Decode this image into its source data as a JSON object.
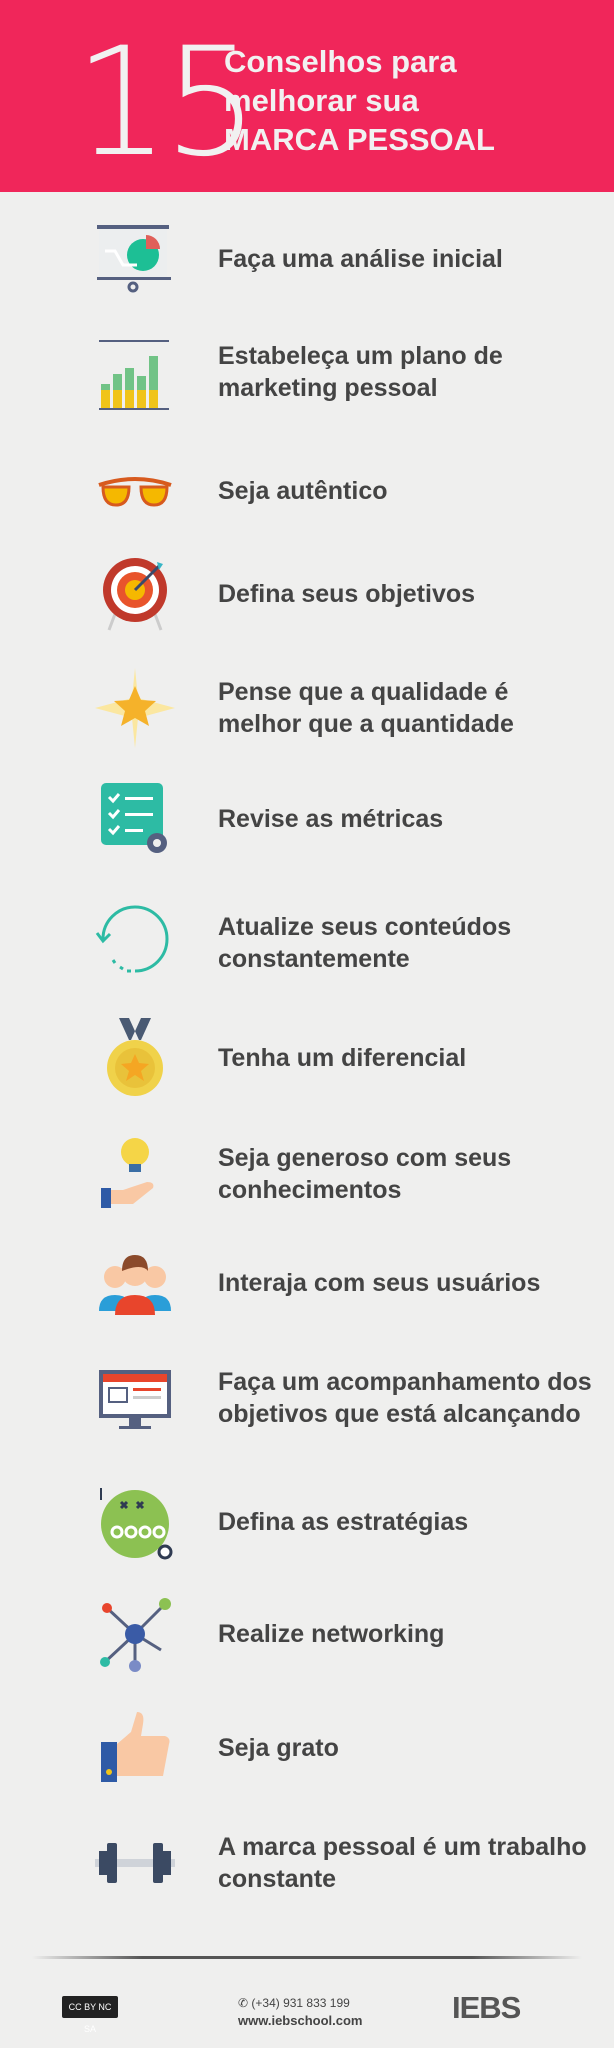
{
  "header": {
    "number": "15",
    "title_line1": "Conselhos para",
    "title_line2": "melhorar sua",
    "title_line3": "MARCA PESSOAL",
    "background": "#f0265a"
  },
  "tips": [
    {
      "text": "Faça uma análise inicial",
      "icon": "presentation-pie-chart-icon"
    },
    {
      "text": "Estabeleça um plano de marketing pessoal",
      "icon": "bar-chart-icon"
    },
    {
      "text": "Seja autêntico",
      "icon": "sunglasses-icon"
    },
    {
      "text": "Defina seus objetivos",
      "icon": "target-icon"
    },
    {
      "text": "Pense que a qualidade é melhor que a quantidade",
      "icon": "star-icon"
    },
    {
      "text": "Revise as métricas",
      "icon": "checklist-gear-icon"
    },
    {
      "text": "Atualize seus conteúdos constantemente",
      "icon": "refresh-icon"
    },
    {
      "text": "Tenha um diferencial",
      "icon": "medal-icon"
    },
    {
      "text": "Seja generoso com seus conhecimentos",
      "icon": "lightbulb-hand-icon"
    },
    {
      "text": "Interaja com seus usuários",
      "icon": "users-icon"
    },
    {
      "text": "Faça um acompanhamento dos objetivos que está alcançando",
      "icon": "monitor-shop-icon"
    },
    {
      "text": "Defina as estratégias",
      "icon": "strategy-board-icon"
    },
    {
      "text": "Realize networking",
      "icon": "network-icon"
    },
    {
      "text": "Seja grato",
      "icon": "thumbs-up-icon"
    },
    {
      "text": "A marca pessoal é um trabalho constante",
      "icon": "dumbbell-icon"
    }
  ],
  "footer": {
    "license": "CC BY NC SA",
    "phone": "(+34) 931 833 199",
    "website": "www.iebschool.com",
    "logo": "IEBS"
  }
}
